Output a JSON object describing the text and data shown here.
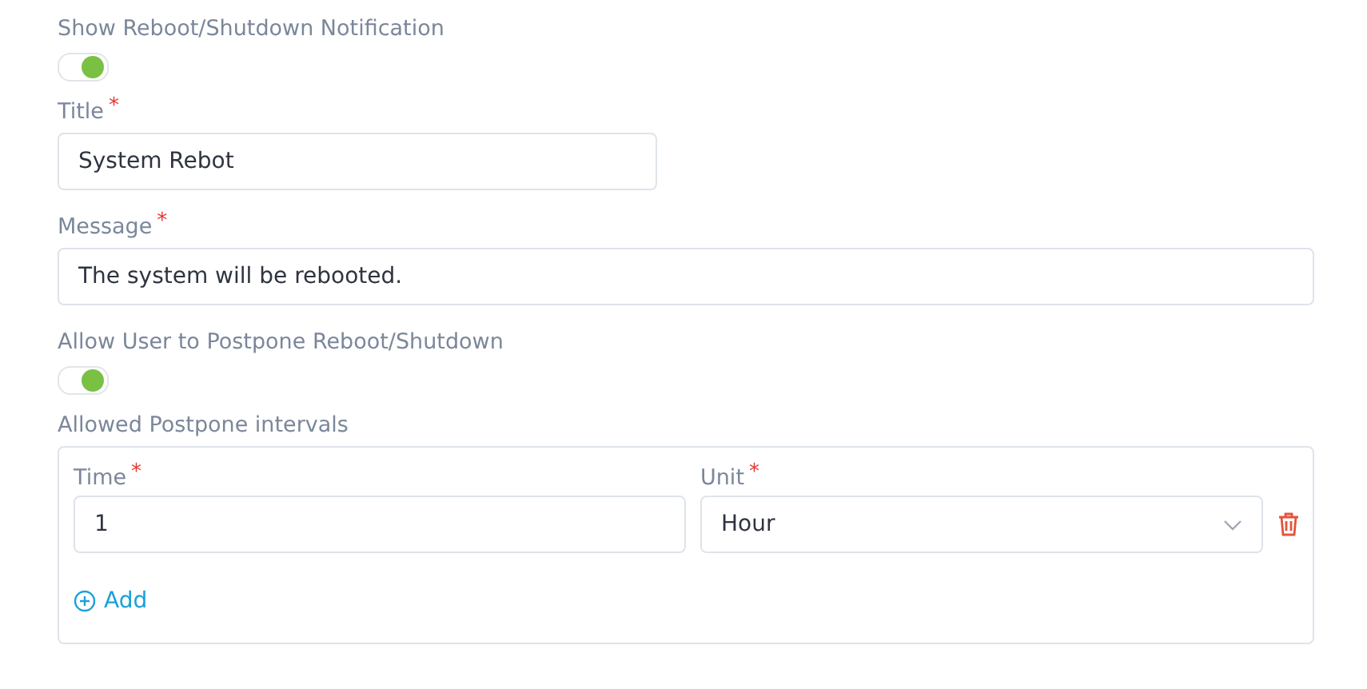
{
  "notification_toggle": {
    "label": "Show Reboot/Shutdown Notification",
    "on": true
  },
  "title_field": {
    "label": "Title",
    "required_mark": "*",
    "value": "System Rebot"
  },
  "message_field": {
    "label": "Message",
    "required_mark": "*",
    "value": "The system will be rebooted."
  },
  "postpone_toggle": {
    "label": "Allow User to Postpone Reboot/Shutdown",
    "on": true
  },
  "intervals": {
    "label": "Allowed Postpone intervals",
    "time_label": "Time",
    "time_required_mark": "*",
    "unit_label": "Unit",
    "unit_required_mark": "*",
    "rows": [
      {
        "time": "1",
        "unit": "Hour"
      }
    ],
    "add_label": "Add"
  }
}
